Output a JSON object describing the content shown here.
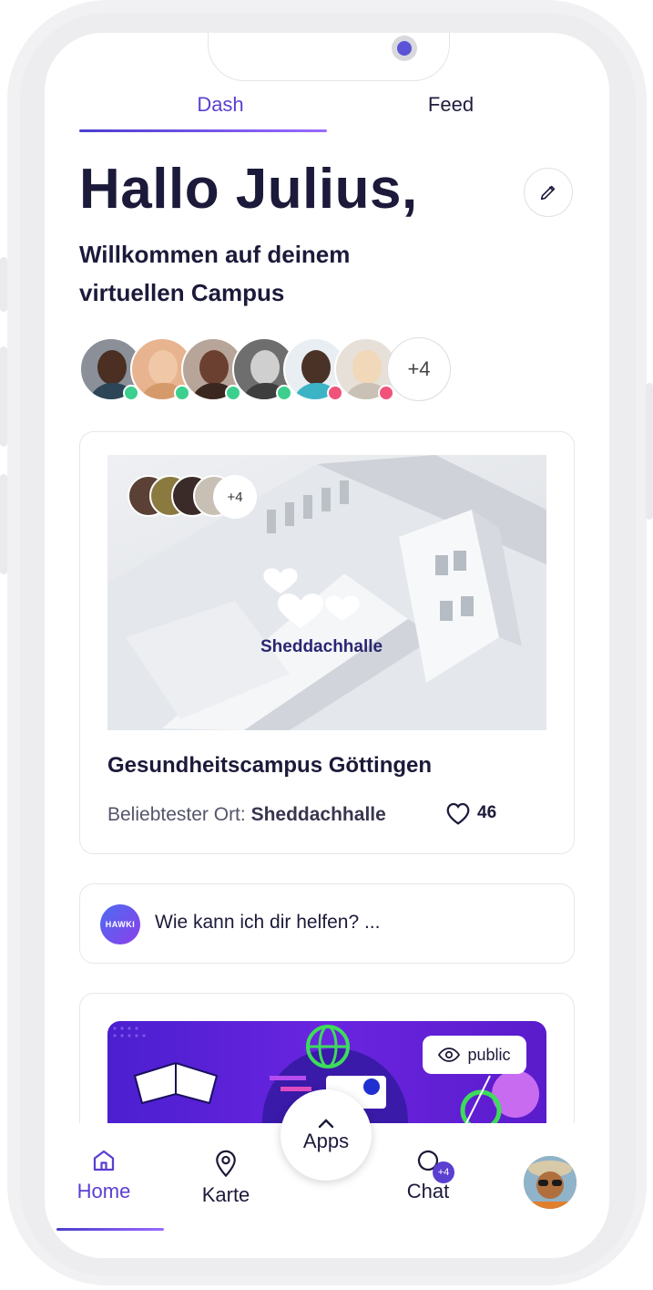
{
  "tabs": {
    "dash": "Dash",
    "feed": "Feed"
  },
  "greeting": "Hallo Julius,",
  "welcome": "Willkommen auf deinem virtuellen Campus",
  "avatars": {
    "more": "+4"
  },
  "campus_card": {
    "place_label": "Sheddachhalle",
    "visitors_more": "+4",
    "title": "Gesundheitscampus Göttingen",
    "subtitle_prefix": "Beliebtester Ort:",
    "subtitle_place": "Sheddachhalle",
    "likes": "46"
  },
  "assistant": {
    "logo": "HAWKI",
    "prompt": "Wie kann ich dir helfen? ..."
  },
  "app_banner": {
    "visibility": "public"
  },
  "nav": {
    "home": "Home",
    "karte": "Karte",
    "apps": "Apps",
    "chat": "Chat",
    "chat_badge": "+4"
  },
  "colors": {
    "accent": "#5b3fd0",
    "online": "#3ccf8e",
    "busy": "#f0527a",
    "text": "#1c1a3a"
  }
}
